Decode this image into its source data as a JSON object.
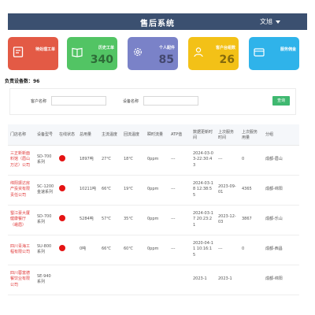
{
  "header": {
    "title": "售后系统",
    "user": "文旭"
  },
  "cards": [
    {
      "label": "待处理工单",
      "value": "",
      "icon": "document-icon",
      "color": "#e35a45"
    },
    {
      "label": "历史工单",
      "value": "340",
      "icon": "book-icon",
      "color": "#52c464"
    },
    {
      "label": "个人配件",
      "value": "85",
      "icon": "gear-icon",
      "color": "#7a82c8"
    },
    {
      "label": "客户台组数",
      "value": "26",
      "icon": "person-icon",
      "color": "#f3c117"
    },
    {
      "label": "服务佣金",
      "value": "",
      "icon": "wallet-icon",
      "color": "#2fb3ea"
    }
  ],
  "device_count": "负责设备数：96",
  "filter": {
    "customer_label": "客户名称",
    "customer_value": "",
    "device_label": "设备名称",
    "device_value": "",
    "query_button": "查询"
  },
  "table": {
    "headers": [
      "门店名称",
      "设备型号",
      "在线状态",
      "总用量",
      "主流温度",
      "回流温度",
      "瞬时流量",
      "ATP值",
      "数据更新时间",
      "上次服务时间",
      "上次服务用量",
      "分组"
    ],
    "rows": [
      [
        "三正新新面料馆（眉山万达）公司",
        "SD-700系列",
        "",
        "1897吨",
        "27℃",
        "18℃",
        "0ppm",
        "---",
        "2024-03-03-22:30:43",
        "---",
        "0",
        "成都-眉山"
      ],
      [
        "绵阳振达房产投资有限责任公司",
        "SC-1200金速系列",
        "",
        "10211吨",
        "66℃",
        "19℃",
        "0ppm",
        "---",
        "2024-03-18 12:38:55",
        "2023-09-01",
        "4365",
        "成都-绵阳"
      ],
      [
        "蜀江豪大厦健康餐厅（峨眉）",
        "SD-700系列",
        "",
        "5284吨",
        "57℃",
        "35℃",
        "0ppm",
        "---",
        "2024-03-17 20:23:21",
        "2023-12-03",
        "3867",
        "成都-乐山"
      ],
      [
        "四川青海工程有限公司",
        "SU-800系列",
        "",
        "0吨",
        "66℃",
        "60℃",
        "0ppm",
        "---",
        "2020-04-11 10:16:15",
        "---",
        "0",
        "成都-西昌"
      ],
      [
        "四川蓉富德餐饮业有限公司",
        "SE-940系列",
        "",
        "",
        "",
        "",
        "",
        "",
        "2023-1",
        "2023-1",
        "",
        "成都-绵阳"
      ]
    ]
  }
}
